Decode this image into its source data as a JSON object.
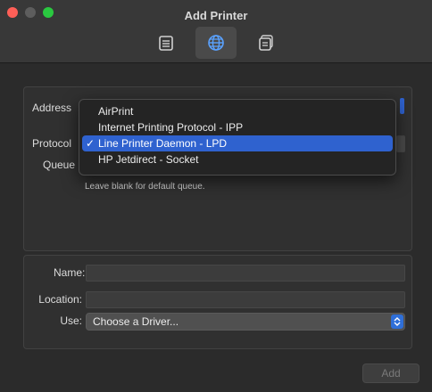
{
  "window": {
    "title": "Add Printer"
  },
  "toolbar": {
    "tools": [
      {
        "name": "default",
        "icon": "printer-icon",
        "selected": false
      },
      {
        "name": "ip",
        "icon": "globe-icon",
        "selected": true
      },
      {
        "name": "windows",
        "icon": "printer-stack-icon",
        "selected": false
      }
    ]
  },
  "ip_panel": {
    "address_label": "Address",
    "protocol_label": "Protocol",
    "queue_label": "Queue",
    "queue_hint": "Leave blank for default queue."
  },
  "protocol_menu": {
    "items": [
      {
        "label": "AirPrint",
        "selected": false
      },
      {
        "label": "Internet Printing Protocol - IPP",
        "selected": false
      },
      {
        "label": "Line Printer Daemon - LPD",
        "selected": true
      },
      {
        "label": "HP Jetdirect - Socket",
        "selected": false
      }
    ],
    "check_mark": "✓"
  },
  "details": {
    "name_label": "Name:",
    "location_label": "Location:",
    "use_label": "Use:",
    "use_value": "Choose a Driver..."
  },
  "buttons": {
    "add_label": "Add"
  },
  "colors": {
    "accent": "#2f62cf",
    "background": "#2b2b2b"
  }
}
